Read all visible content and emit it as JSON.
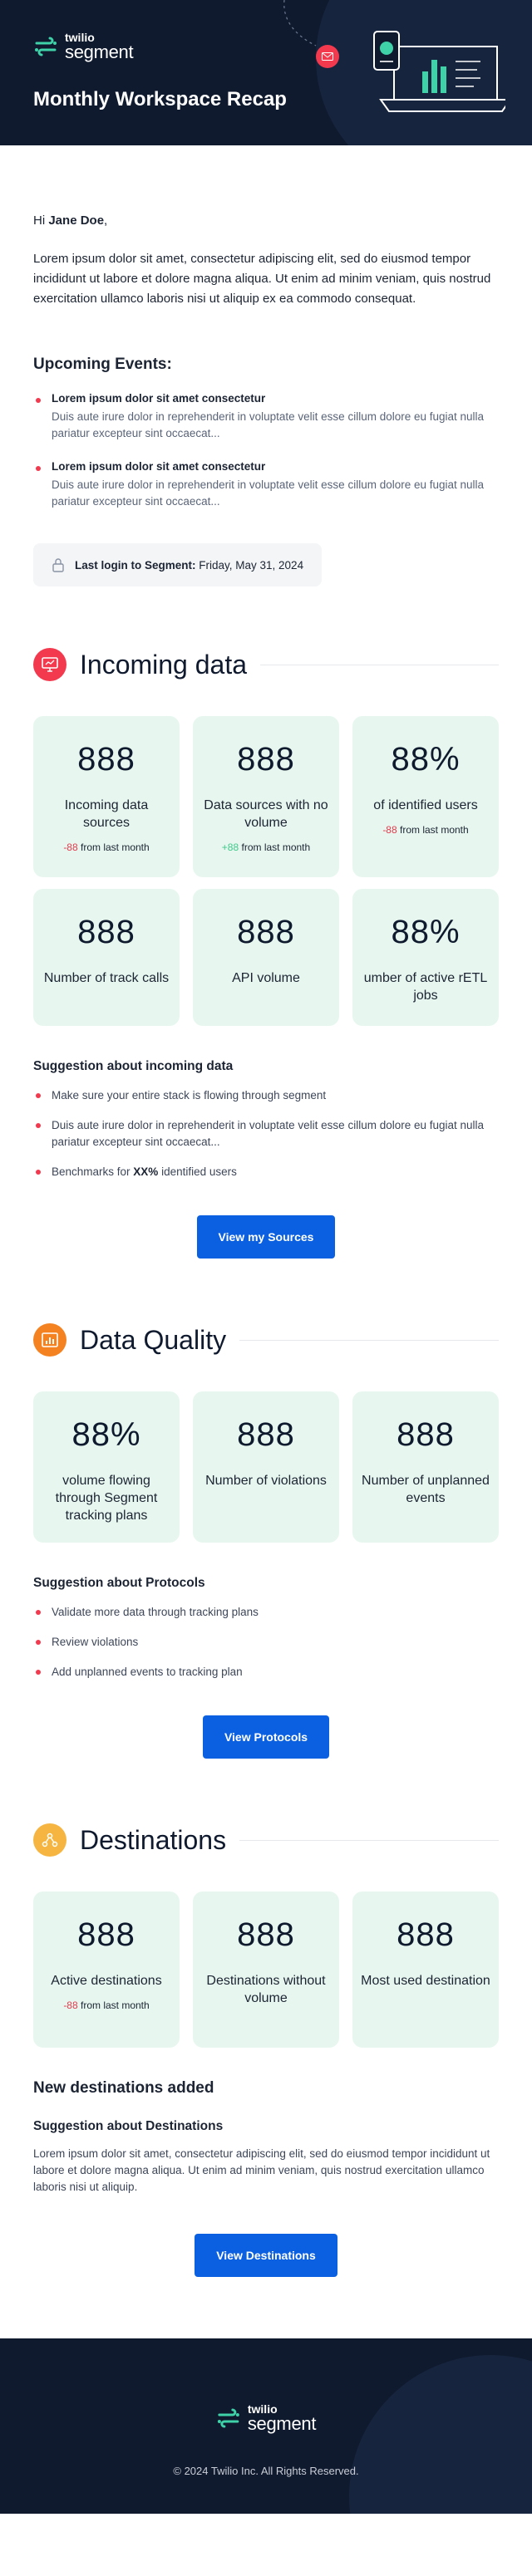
{
  "brand": {
    "line1": "twilio",
    "line2": "segment"
  },
  "header": {
    "title": "Monthly Workspace Recap"
  },
  "greeting": {
    "prefix": "Hi ",
    "name": "Jane Doe",
    "suffix": ","
  },
  "intro": "Lorem ipsum dolor sit amet, consectetur adipiscing elit, sed do eiusmod tempor incididunt ut labore et dolore magna aliqua. Ut enim ad minim veniam, quis nostrud exercitation ullamco laboris nisi ut aliquip ex ea commodo consequat.",
  "events": {
    "title": "Upcoming Events:",
    "items": [
      {
        "title": "Lorem ipsum dolor sit amet consectetur",
        "body": "Duis aute irure dolor in reprehenderit in voluptate velit esse cillum dolore eu fugiat nulla pariatur excepteur sint occaecat..."
      },
      {
        "title": "Lorem ipsum dolor sit amet consectetur",
        "body": "Duis aute irure dolor in reprehenderit in voluptate velit esse cillum dolore eu fugiat nulla pariatur excepteur sint occaecat..."
      }
    ]
  },
  "login": {
    "label": "Last login to Segment:",
    "date": " Friday, May 31, 2024"
  },
  "incoming": {
    "title": "Incoming data",
    "icon": "monitor-icon",
    "icon_color": "#f2394e",
    "cards": [
      {
        "value": "888",
        "label": "Incoming data sources",
        "delta": "-88",
        "delta_text": " from last month"
      },
      {
        "value": "888",
        "label": "Data sources with no volume",
        "delta": "+88",
        "delta_text": " from last month"
      },
      {
        "value": "88%",
        "label": "of identified users",
        "delta": "-88",
        "delta_text": " from last month"
      },
      {
        "value": "888",
        "label": "Number of track calls"
      },
      {
        "value": "888",
        "label": "API volume"
      },
      {
        "value": "88%",
        "label": "umber of active rETL jobs"
      }
    ],
    "suggestion_title": "Suggestion about incoming data",
    "suggestions": [
      "Make sure your entire stack is flowing through segment",
      "Duis aute irure dolor in reprehenderit in voluptate velit esse cillum dolore eu fugiat nulla pariatur excepteur sint occaecat...",
      "Benchmarks for "
    ],
    "bench_bold": "XX%",
    "bench_tail": " identified users",
    "button": "View my Sources"
  },
  "quality": {
    "title": "Data Quality",
    "icon": "bar-chart-icon",
    "icon_color": "#f58220",
    "cards": [
      {
        "value": "88%",
        "label": "volume flowing through Segment tracking plans"
      },
      {
        "value": "888",
        "label": "Number of violations"
      },
      {
        "value": "888",
        "label": "Number of unplanned events"
      }
    ],
    "suggestion_title": "Suggestion about Protocols",
    "suggestions": [
      "Validate more data through tracking plans",
      "Review violations",
      "Add unplanned events to tracking plan"
    ],
    "button": "View Protocols"
  },
  "destinations": {
    "title": "Destinations",
    "icon": "network-icon",
    "icon_color": "#f5b540",
    "cards": [
      {
        "value": "888",
        "label": "Active destinations",
        "delta": "-88",
        "delta_text": " from last month"
      },
      {
        "value": "888",
        "label": "Destinations without volume"
      },
      {
        "value": "888",
        "label": "Most used destination"
      }
    ],
    "new_title": "New destinations added",
    "suggestion_title": "Suggestion about Destinations",
    "suggestion_text": "Lorem ipsum dolor sit amet, consectetur adipiscing elit, sed do eiusmod tempor incididunt ut labore et dolore magna aliqua. Ut enim ad minim veniam, quis nostrud exercitation ullamco laboris nisi ut aliquip.",
    "button": "View Destinations"
  },
  "footer": {
    "copyright": "© 2024 Twilio Inc. All Rights Reserved."
  }
}
